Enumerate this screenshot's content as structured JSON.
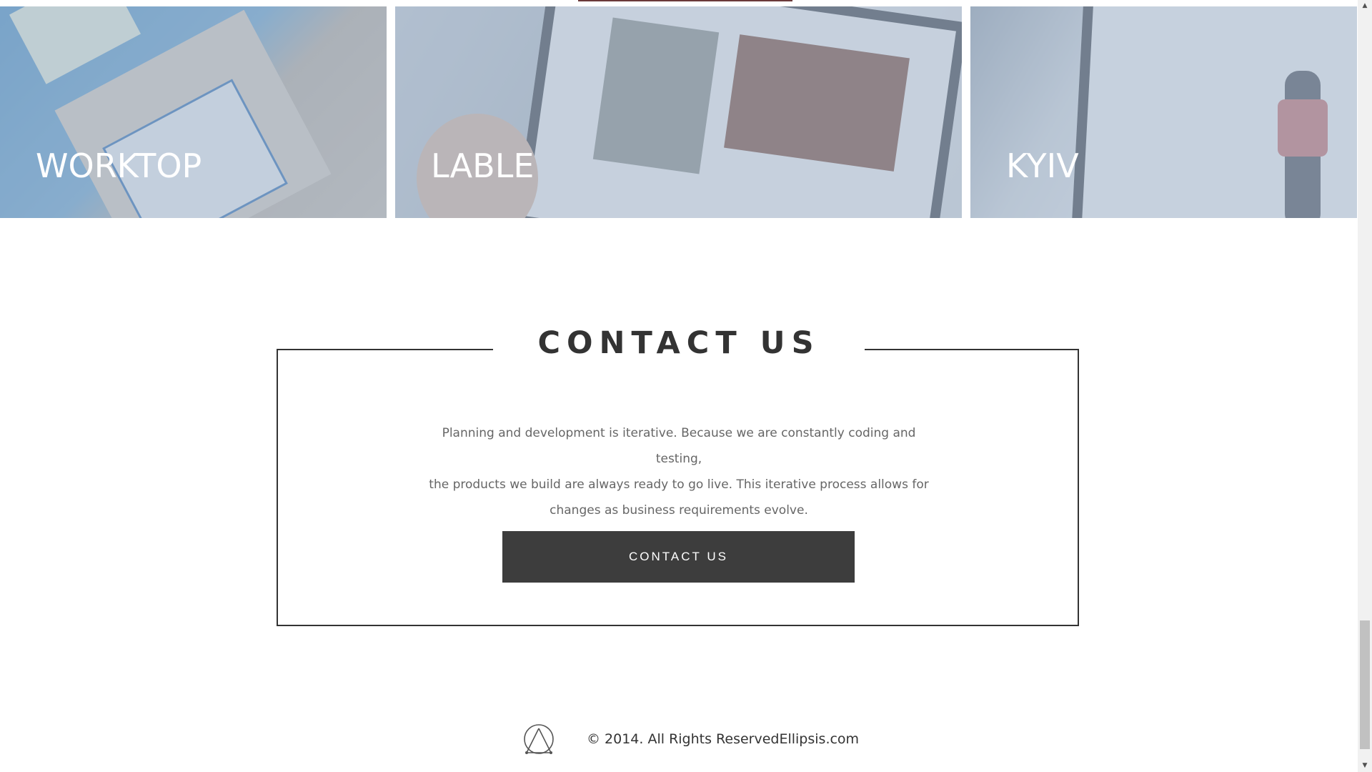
{
  "colors": {
    "accent": "#6b3a3a",
    "button_bg": "#3d3d3d",
    "button_text": "#ffffff",
    "heading": "#333333",
    "body_text": "#666666"
  },
  "portfolio": {
    "tiles": [
      {
        "label": "WORKTOP"
      },
      {
        "label": "LABLE"
      },
      {
        "label": "KYIV"
      }
    ]
  },
  "contact": {
    "title": "CONTACT US",
    "description_lines": [
      "Planning and development is iterative. Because we are constantly coding and testing,",
      "the products we build are always ready to go live. This iterative process allows for",
      "changes as business requirements evolve."
    ],
    "button_label": "CONTACT US"
  },
  "footer": {
    "logo_icon": "ellipsis-logo-icon",
    "copyright": "© 2014. All Rights ReservedEllipsis.com"
  },
  "scrollbar": {
    "up_arrow_icon": "scroll-up-arrow-icon",
    "down_arrow_icon": "scroll-down-arrow-icon"
  }
}
